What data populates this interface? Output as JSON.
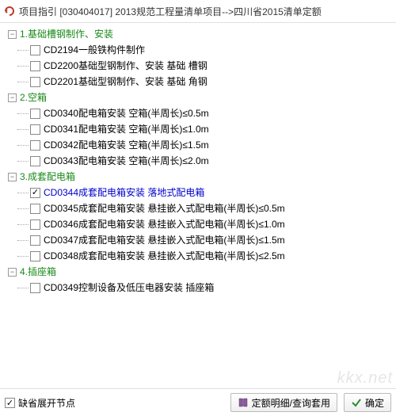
{
  "title": "项目指引  [030404017]  2013规范工程量清单项目-->四川省2015清单定额",
  "sections": [
    {
      "num": "1",
      "label": "1.基础槽钢制作、安装",
      "items": [
        {
          "code": "CD2194",
          "label": "一般铁构件制作",
          "checked": false,
          "hl": false
        },
        {
          "code": "CD2200",
          "label": "基础型钢制作、安装 基础 槽钢",
          "checked": false,
          "hl": false
        },
        {
          "code": "CD2201",
          "label": "基础型钢制作、安装 基础 角钢",
          "checked": false,
          "hl": false
        }
      ]
    },
    {
      "num": "2",
      "label": "2.空箱",
      "items": [
        {
          "code": "CD0340",
          "label": "配电箱安装 空箱(半周长)≤0.5m",
          "checked": false,
          "hl": false
        },
        {
          "code": "CD0341",
          "label": "配电箱安装 空箱(半周长)≤1.0m",
          "checked": false,
          "hl": false
        },
        {
          "code": "CD0342",
          "label": "配电箱安装 空箱(半周长)≤1.5m",
          "checked": false,
          "hl": false
        },
        {
          "code": "CD0343",
          "label": "配电箱安装 空箱(半周长)≤2.0m",
          "checked": false,
          "hl": false
        }
      ]
    },
    {
      "num": "3",
      "label": "3.成套配电箱",
      "items": [
        {
          "code": "CD0344",
          "label": "成套配电箱安装  落地式配电箱",
          "checked": true,
          "hl": true
        },
        {
          "code": "CD0345",
          "label": "成套配电箱安装 悬挂嵌入式配电箱(半周长)≤0.5m",
          "checked": false,
          "hl": false
        },
        {
          "code": "CD0346",
          "label": "成套配电箱安装 悬挂嵌入式配电箱(半周长)≤1.0m",
          "checked": false,
          "hl": false
        },
        {
          "code": "CD0347",
          "label": "成套配电箱安装 悬挂嵌入式配电箱(半周长)≤1.5m",
          "checked": false,
          "hl": false
        },
        {
          "code": "CD0348",
          "label": "成套配电箱安装 悬挂嵌入式配电箱(半周长)≤2.5m",
          "checked": false,
          "hl": false
        }
      ]
    },
    {
      "num": "4",
      "label": "4.插座箱",
      "items": [
        {
          "code": "CD0349",
          "label": "控制设备及低压电器安装 插座箱",
          "checked": false,
          "hl": false
        }
      ]
    }
  ],
  "footer": {
    "expand_label": "缺省展开节点",
    "expand_checked": true,
    "btn_detail": "定额明细/查询套用",
    "btn_ok": "确定"
  },
  "watermark": "kkx.net"
}
